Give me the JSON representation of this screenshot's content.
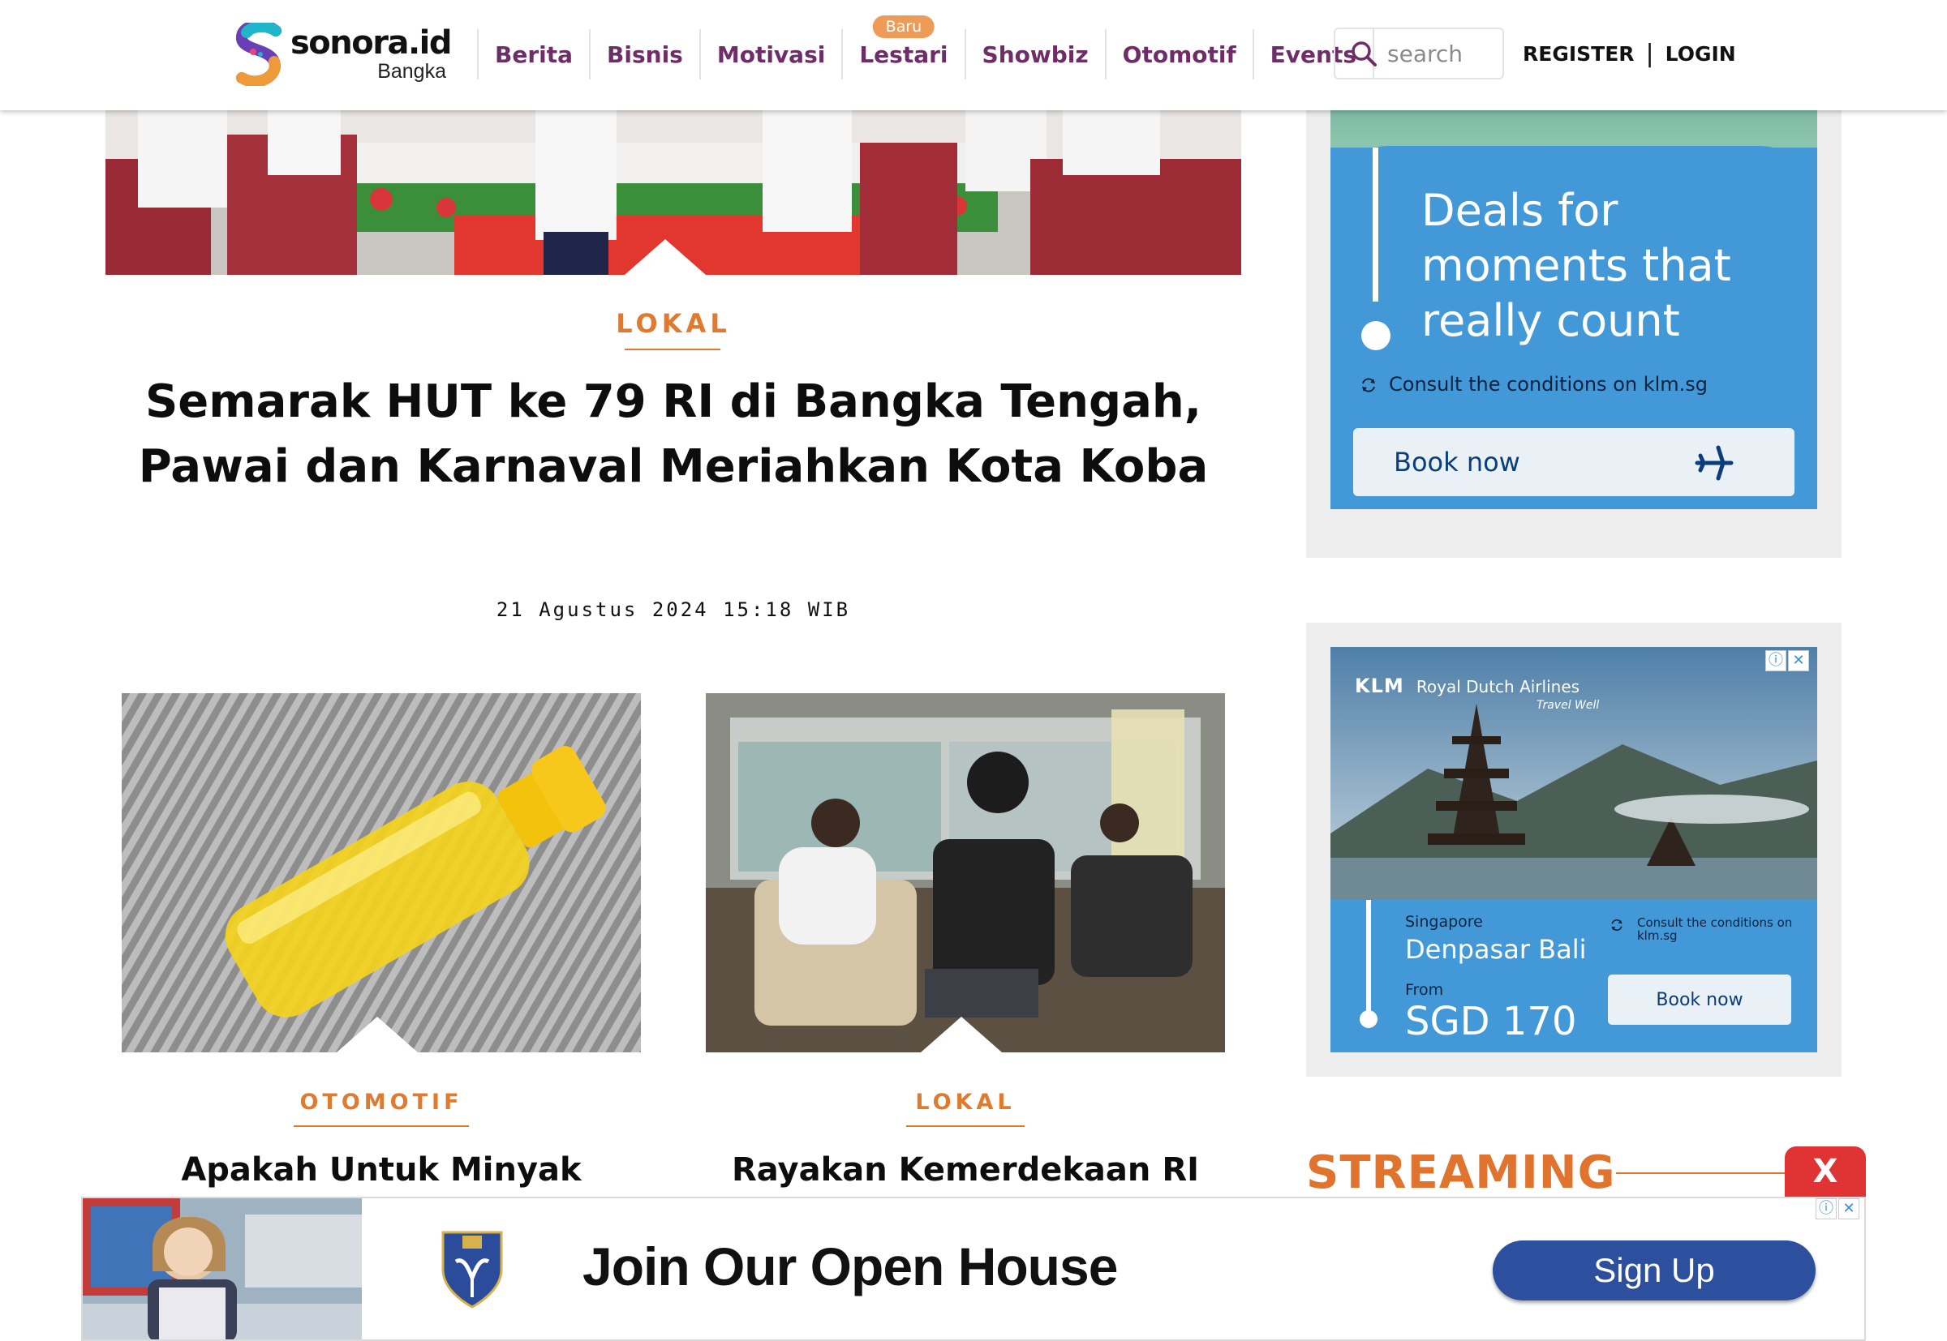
{
  "header": {
    "logo": {
      "name": "sonora.id",
      "city": "Bangka"
    },
    "nav": [
      {
        "label": "Berita"
      },
      {
        "label": "Bisnis"
      },
      {
        "label": "Motivasi"
      },
      {
        "label": "Lestari",
        "badge": "Baru"
      },
      {
        "label": "Showbiz"
      },
      {
        "label": "Otomotif"
      },
      {
        "label": "Events"
      }
    ],
    "search": {
      "placeholder": "search"
    },
    "register_label": "REGISTER",
    "separator": "|",
    "login_label": "LOGIN"
  },
  "featured": {
    "category": "LOKAL",
    "title": "Semarak HUT ke 79 RI di Bangka Tengah, Pawai dan Karnaval Meriahkan Kota Koba",
    "date": "21 Agustus 2024 15:18 WIB"
  },
  "cards": [
    {
      "category": "OTOMOTIF",
      "title": "Apakah Untuk Minyak"
    },
    {
      "category": "LOKAL",
      "title": "Rayakan Kemerdekaan RI"
    }
  ],
  "ad_klm_1": {
    "headline": "Deals for moments that really count",
    "conditions": "Consult the conditions on klm.sg",
    "button": "Book now"
  },
  "ad_klm_2": {
    "brand": "KLM",
    "airline": "Royal Dutch Airlines",
    "tagline": "Travel Well",
    "origin": "Singapore",
    "destination": "Denpasar Bali",
    "from_label": "From",
    "price": "SGD 170",
    "conditions": "Consult the conditions on klm.sg",
    "button": "Book now"
  },
  "streaming": {
    "title": "STREAMING"
  },
  "sticky_ad": {
    "close_label": "X",
    "headline": "Join Our Open House",
    "button": "Sign Up"
  },
  "colors": {
    "brand_purple": "#6e2d67",
    "accent_orange": "#e07a2e",
    "klm_blue": "#4399d7",
    "sticky_button": "#2c4f9e",
    "close_red": "#e03434"
  }
}
